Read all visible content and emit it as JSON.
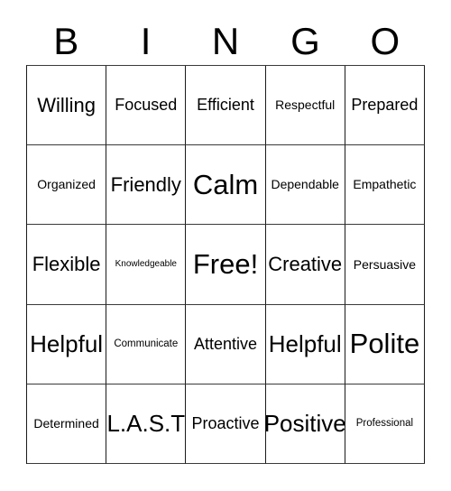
{
  "card": {
    "headers": [
      "B",
      "I",
      "N",
      "G",
      "O"
    ],
    "rows": [
      [
        {
          "label": "Willing",
          "size": "lg"
        },
        {
          "label": "Focused",
          "size": "md"
        },
        {
          "label": "Efficient",
          "size": "md"
        },
        {
          "label": "Respectful",
          "size": "sm"
        },
        {
          "label": "Prepared",
          "size": "md"
        }
      ],
      [
        {
          "label": "Organized",
          "size": "sm"
        },
        {
          "label": "Friendly",
          "size": "lg"
        },
        {
          "label": "Calm",
          "size": "xxl"
        },
        {
          "label": "Dependable",
          "size": "sm"
        },
        {
          "label": "Empathetic",
          "size": "sm"
        }
      ],
      [
        {
          "label": "Flexible",
          "size": "lg"
        },
        {
          "label": "Knowledgeable",
          "size": "xxs"
        },
        {
          "label": "Free!",
          "size": "xxl"
        },
        {
          "label": "Creative",
          "size": "lg"
        },
        {
          "label": "Persuasive",
          "size": "sm"
        }
      ],
      [
        {
          "label": "Helpful",
          "size": "xl"
        },
        {
          "label": "Communicate",
          "size": "xs"
        },
        {
          "label": "Attentive",
          "size": "md"
        },
        {
          "label": "Helpful",
          "size": "xl"
        },
        {
          "label": "Polite",
          "size": "xxl"
        }
      ],
      [
        {
          "label": "Determined",
          "size": "sm"
        },
        {
          "label": "L.A.S.T",
          "size": "xl"
        },
        {
          "label": "Proactive",
          "size": "md"
        },
        {
          "label": "Positive",
          "size": "xl"
        },
        {
          "label": "Professional",
          "size": "xs"
        }
      ]
    ]
  }
}
